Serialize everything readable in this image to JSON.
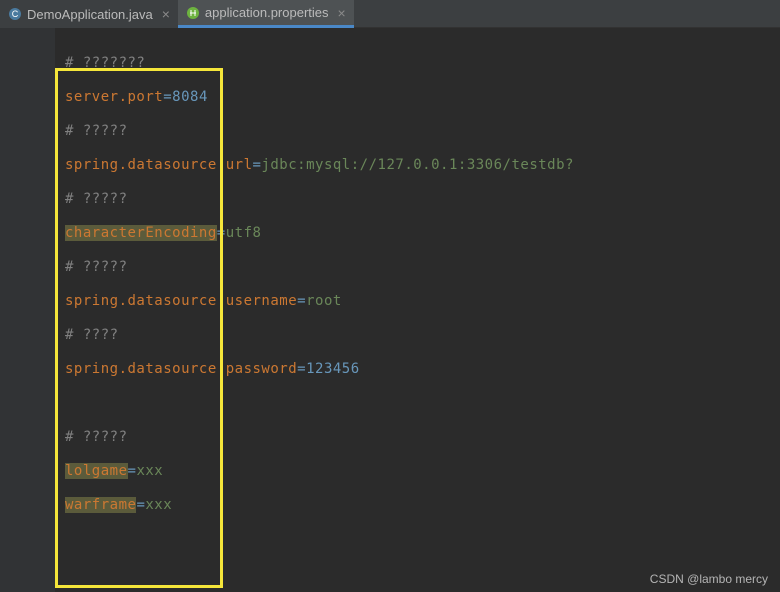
{
  "tabs": [
    {
      "label": "DemoApplication.java",
      "icon": "java-class-icon",
      "active": false
    },
    {
      "label": "application.properties",
      "icon": "spring-config-icon",
      "active": true
    }
  ],
  "code": {
    "lines": [
      {
        "type": "comment",
        "text": "# ???????"
      },
      {
        "type": "prop",
        "key": "server.port",
        "eq": "=",
        "val": "8084",
        "valClass": "value-num"
      },
      {
        "type": "comment",
        "text": "# ?????"
      },
      {
        "type": "prop",
        "key": "spring.datasource.url",
        "eq": "=",
        "val": "jdbc:mysql://127.0.0.1:3306/testdb?",
        "valClass": "value-str"
      },
      {
        "type": "comment",
        "text": "# ?????"
      },
      {
        "type": "prop",
        "key": "characterEncoding",
        "eq": "=",
        "val": "utf8",
        "valClass": "value-str",
        "keyHighlight": true
      },
      {
        "type": "comment",
        "text": "# ?????"
      },
      {
        "type": "prop",
        "key": "spring.datasource.username",
        "eq": "=",
        "val": "root",
        "valClass": "value-str"
      },
      {
        "type": "comment",
        "text": "# ????"
      },
      {
        "type": "prop",
        "key": "spring.datasource.password",
        "eq": "=",
        "val": "123456",
        "valClass": "value-num"
      },
      {
        "type": "blank",
        "text": ""
      },
      {
        "type": "comment",
        "text": "# ?????"
      },
      {
        "type": "prop",
        "key": "lolgame",
        "eq": "=",
        "val": "xxx",
        "valClass": "value-str",
        "keyHighlight": true
      },
      {
        "type": "prop",
        "key": "warframe",
        "eq": "=",
        "val": "xxx",
        "valClass": "value-str",
        "keyHighlight": true
      }
    ]
  },
  "watermark": "CSDN @lambo mercy"
}
